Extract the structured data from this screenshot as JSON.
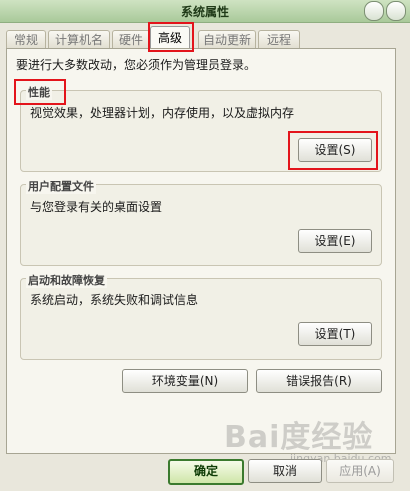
{
  "window": {
    "title": "系统属性"
  },
  "tabs": [
    {
      "label": "常规"
    },
    {
      "label": "计算机名"
    },
    {
      "label": "硬件"
    },
    {
      "label": "高级"
    },
    {
      "label": "自动更新"
    },
    {
      "label": "远程"
    }
  ],
  "active_tab": "高级",
  "notice": "要进行大多数改动，您必须作为管理员登录。",
  "groups": {
    "performance": {
      "label": "性能",
      "desc": "视觉效果，处理器计划，内存使用，以及虚拟内存",
      "button": "设置(S)"
    },
    "profile": {
      "label": "用户配置文件",
      "desc": "与您登录有关的桌面设置",
      "button": "设置(E)"
    },
    "startup": {
      "label": "启动和故障恢复",
      "desc": "系统启动，系统失败和调试信息",
      "button": "设置(T)"
    }
  },
  "buttons": {
    "env": "环境变量(N)",
    "error": "错误报告(R)",
    "ok": "确定",
    "cancel": "取消",
    "apply": "应用(A)"
  },
  "watermark": {
    "main": "Bai度经验",
    "sub": "jingyan.baidu.com"
  },
  "colors": {
    "highlight": "#e3141b",
    "ok_border": "#3b7a2e"
  }
}
